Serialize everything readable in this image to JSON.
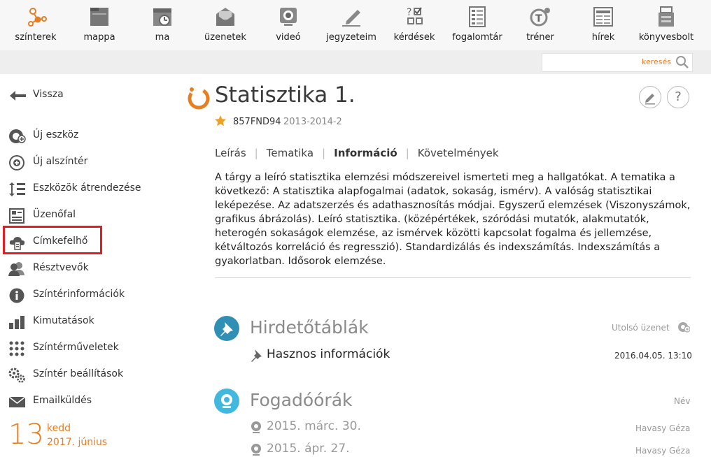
{
  "toolbar": {
    "items": [
      {
        "label": "színterek",
        "icon": "network-icon"
      },
      {
        "label": "mappa",
        "icon": "folder-icon"
      },
      {
        "label": "ma",
        "icon": "calendar-clock-icon"
      },
      {
        "label": "üzenetek",
        "icon": "envelope-icon"
      },
      {
        "label": "videó",
        "icon": "webcam-icon"
      },
      {
        "label": "jegyzeteim",
        "icon": "pen-icon"
      },
      {
        "label": "kérdések",
        "icon": "checklist-icon"
      },
      {
        "label": "fogalomtár",
        "icon": "glossary-icon"
      },
      {
        "label": "tréner",
        "icon": "trainer-icon"
      },
      {
        "label": "hírek",
        "icon": "newspaper-icon"
      },
      {
        "label": "könyvesbolt",
        "icon": "bookstore-icon"
      }
    ],
    "search_placeholder": "keresés"
  },
  "sidebar": {
    "back": "Vissza",
    "items": [
      {
        "label": "Új eszköz",
        "icon": "add-tool-icon"
      },
      {
        "label": "Új alszíntér",
        "icon": "add-circle-icon"
      },
      {
        "label": "Eszközök átrendezése",
        "icon": "reorder-icon"
      },
      {
        "label": "Üzenőfal",
        "icon": "message-board-icon"
      },
      {
        "label": "Címkefelhő",
        "icon": "tag-cloud-icon"
      },
      {
        "label": "Résztvevők",
        "icon": "participants-icon"
      },
      {
        "label": "Színtérinformációk",
        "icon": "info-icon"
      },
      {
        "label": "Kimutatások",
        "icon": "bar-chart-icon"
      },
      {
        "label": "Színtérműveletek",
        "icon": "grid-dots-icon"
      },
      {
        "label": "Színtér beállítások",
        "icon": "gears-icon"
      },
      {
        "label": "Emailküldés",
        "icon": "mail-icon"
      }
    ],
    "date": {
      "day": "13",
      "weekday": "kedd",
      "month_year": "2017. június"
    }
  },
  "course": {
    "title": "Statisztika 1.",
    "code": "857FND94",
    "term": "2013-2014-2",
    "tabs": [
      "Leírás",
      "Tematika",
      "Információ",
      "Követelmények"
    ],
    "active_tab": "Információ",
    "description": "A tárgy a leíró statisztika elemzési módszereivel ismerteti meg a hallgatókat.  A tematika a következő: A statisztika alapfogalmai (adatok, sokaság, ismérv). A valóság statisztikai leképezése. Az adatszerzés és adathasznosítás módjai. Egyszerű elemzések (Viszonyszámok, grafikus ábrázolás). Leíró statisztika. (középértékek, szóródási mutatók, alakmutatók, heterogén sokaságok elemzése, az ismérvek közötti kapcsolat fogalma és jellemzése, kétváltozós korreláció és regresszió). Standardizálás és indexszámítás. Indexszámítás a gyakorlatban. Idősorok elemzése."
  },
  "boards": {
    "title": "Hirdetőtáblák",
    "right_label": "Utolsó üzenet",
    "items": [
      {
        "title": "Hasznos információk",
        "date": "2016.04.05. 13:10"
      }
    ]
  },
  "office_hours": {
    "title": "Fogadóórák",
    "right_label": "Név",
    "items": [
      {
        "date": "2015. márc. 30.",
        "name": "Havasy Géza"
      },
      {
        "date": "2015. ápr. 27.",
        "name": "Havasy Géza"
      }
    ]
  },
  "colors": {
    "accent": "#e67e22",
    "teal": "#2f8fb5",
    "cyan": "#43b8de",
    "highlight": "#e02020"
  }
}
